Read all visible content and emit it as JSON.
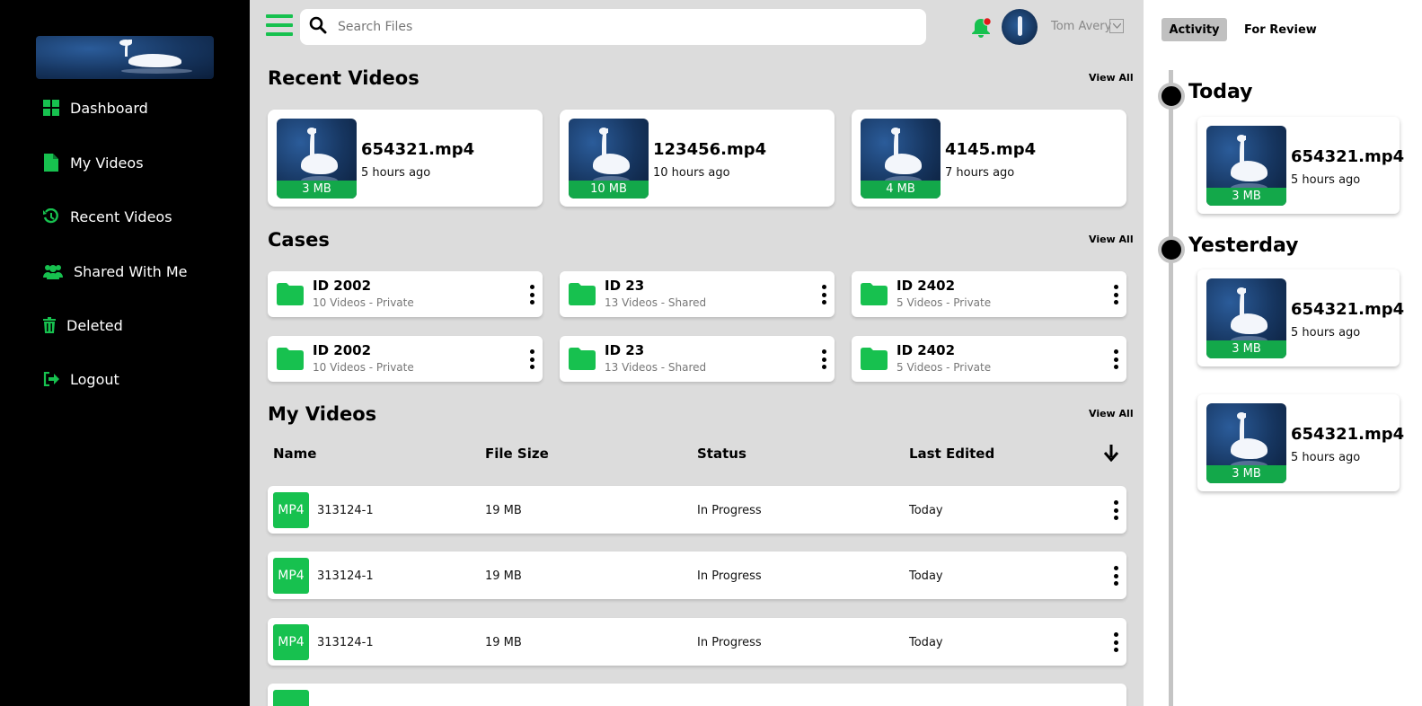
{
  "sidebar": {
    "items": [
      {
        "label": "Dashboard",
        "icon": "grid-icon"
      },
      {
        "label": "My Videos",
        "icon": "file-icon"
      },
      {
        "label": "Recent Videos",
        "icon": "history-icon"
      },
      {
        "label": "Shared With Me",
        "icon": "users-icon"
      },
      {
        "label": "Deleted",
        "icon": "trash-icon"
      },
      {
        "label": "Logout",
        "icon": "logout-icon"
      }
    ]
  },
  "header": {
    "search_placeholder": "Search Files",
    "user_name": "Tom Avery",
    "notification_dot_color": "#e01b1b"
  },
  "colors": {
    "accent": "#17c14f",
    "accent_dark": "#13a84a",
    "sidebar_bg": "#000000",
    "page_bg": "#dcdcdc"
  },
  "recent_videos": {
    "title": "Recent Videos",
    "view_all": "View All",
    "items": [
      {
        "name": "654321.mp4",
        "time": "5 hours ago",
        "size": "3 MB"
      },
      {
        "name": "123456.mp4",
        "time": "10 hours ago",
        "size": "10 MB"
      },
      {
        "name": "4145.mp4",
        "time": "7 hours ago",
        "size": "4 MB"
      }
    ]
  },
  "cases": {
    "title": "Cases",
    "view_all": "View All",
    "items": [
      {
        "id": "ID 2002",
        "sub": "10 Videos - Private"
      },
      {
        "id": "ID 23",
        "sub": "13 Videos - Shared"
      },
      {
        "id": "ID 2402",
        "sub": "5 Videos - Private"
      },
      {
        "id": "ID 2002",
        "sub": "10 Videos - Private"
      },
      {
        "id": "ID 23",
        "sub": "13 Videos - Shared"
      },
      {
        "id": "ID 2402",
        "sub": "5 Videos - Private"
      }
    ]
  },
  "my_videos": {
    "title": "My Videos",
    "view_all": "View All",
    "columns": [
      "Name",
      "File Size",
      "Status",
      "Last Edited"
    ],
    "rows": [
      {
        "type": "MP4",
        "name": "313124-1",
        "size": "19 MB",
        "status": "In Progress",
        "edited": "Today"
      },
      {
        "type": "MP4",
        "name": "313124-1",
        "size": "19 MB",
        "status": "In Progress",
        "edited": "Today"
      },
      {
        "type": "MP4",
        "name": "313124-1",
        "size": "19 MB",
        "status": "In Progress",
        "edited": "Today"
      }
    ]
  },
  "activity": {
    "tabs": [
      "Activity",
      "For Review"
    ],
    "groups": [
      {
        "day": "Today",
        "items": [
          {
            "name": "654321.mp4",
            "time": "5 hours ago",
            "size": "3 MB"
          }
        ]
      },
      {
        "day": "Yesterday",
        "items": [
          {
            "name": "654321.mp4",
            "time": "5 hours ago",
            "size": "3 MB"
          },
          {
            "name": "654321.mp4",
            "time": "5 hours ago",
            "size": "3 MB"
          }
        ]
      }
    ]
  }
}
